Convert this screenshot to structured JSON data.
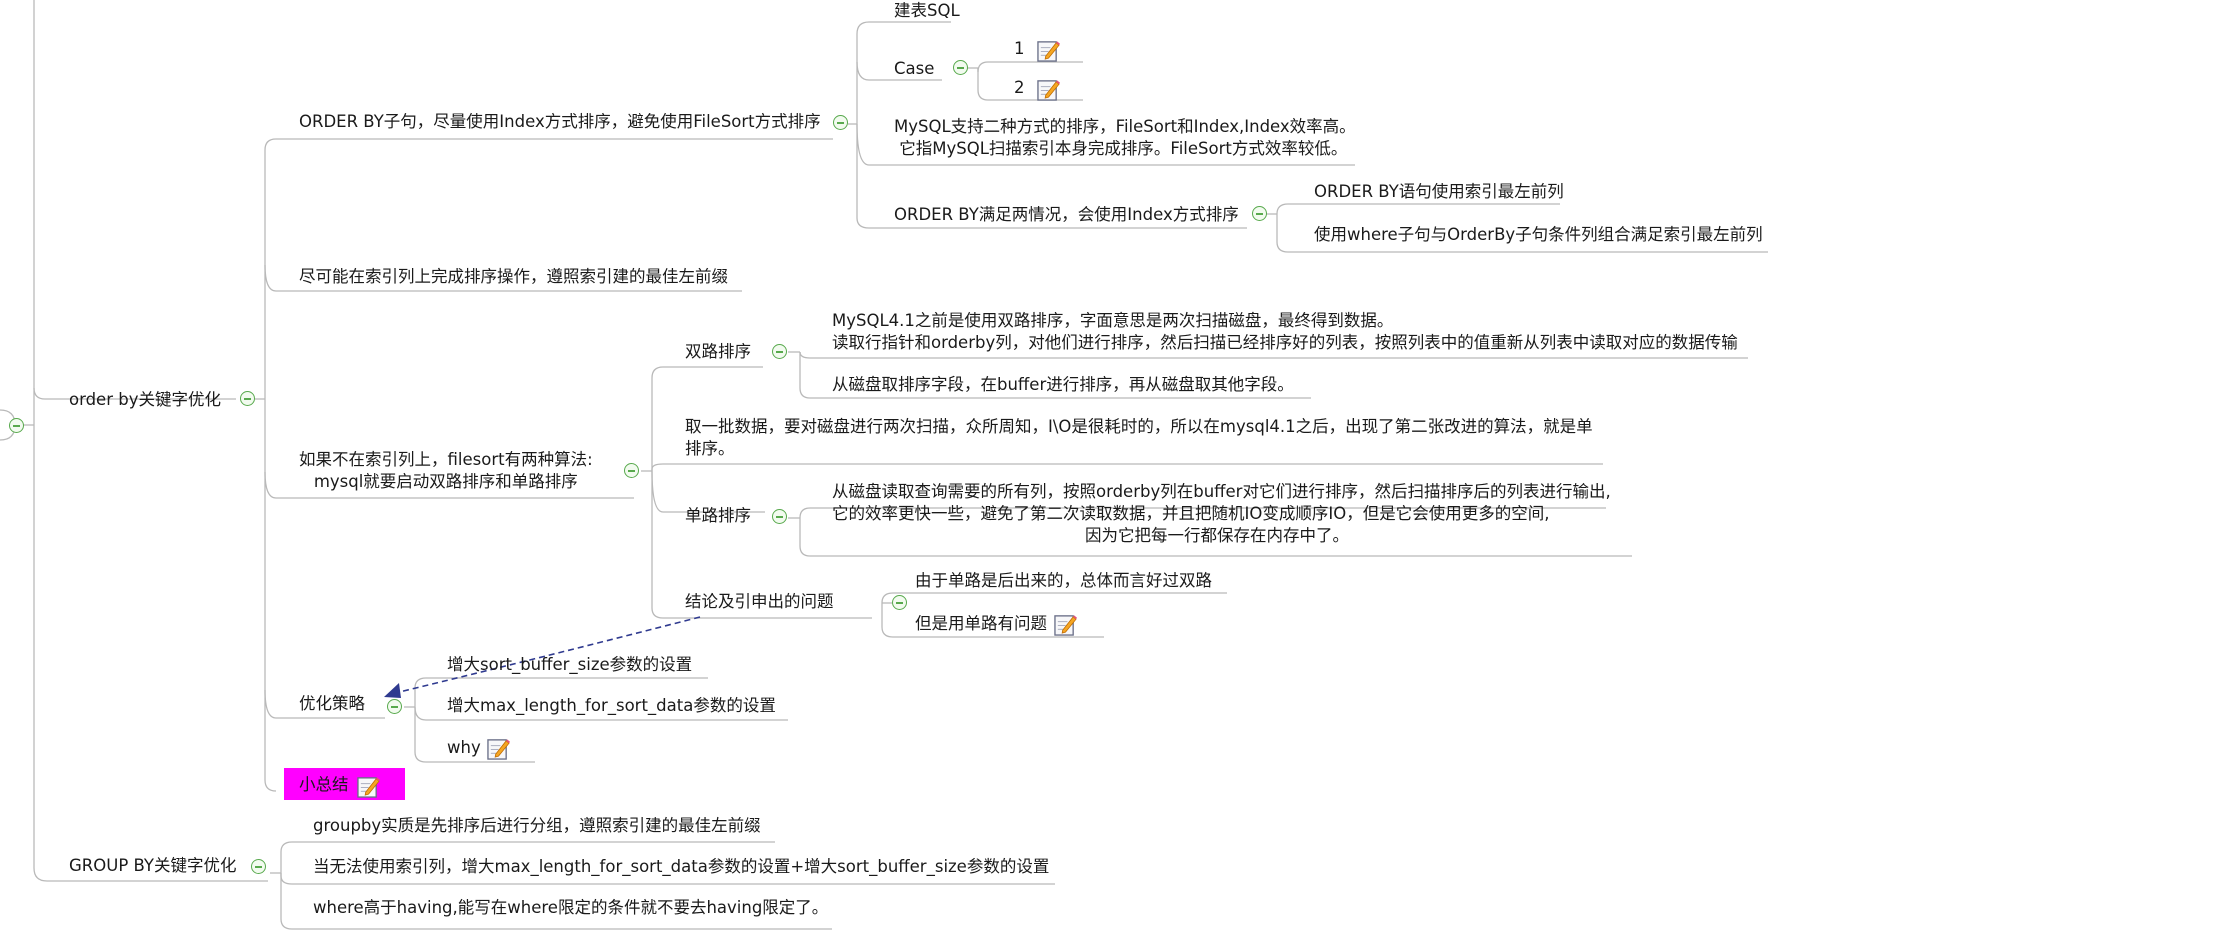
{
  "colors": {
    "line": "#b9b9b9",
    "collapse": "#58a94d",
    "highlight": "#ff00ff",
    "relationship": "#2f3a8f"
  },
  "nodes": {
    "order_by": "order by关键字优化",
    "order_by_clause": "ORDER BY子句，尽量使用Index方式排序，避免使用FileSort方式排序",
    "create_sql": "建表SQL",
    "case": "Case",
    "case_1": "1",
    "case_2": "2",
    "two_sorts": "MySQL支持二种方式的排序，FileSort和Index,Index效率高。\n 它指MySQL扫描索引本身完成排序。FileSort方式效率较低。",
    "two_cases": "ORDER BY满足两情况，会使用Index方式排序",
    "case_leftmost": "ORDER BY语句使用索引最左前列",
    "case_where": "使用where子句与OrderBy子句条件列组合满足索引最左前列",
    "on_index": "尽可能在索引列上完成排序操作，遵照索引建的最佳左前缀",
    "filesort": "如果不在索引列上，filesort有两种算法:\nmysql就要启动双路排序和单路排序",
    "double": "双路排序",
    "double_desc": "MySQL4.1之前是使用双路排序，字面意思是两次扫描磁盘，最终得到数据。\n读取行指针和orderby列，对他们进行排序，然后扫描已经排序好的列表，按照列表中的值重新从列表中读取对应的数据传输",
    "double_step": "从磁盘取排序字段，在buffer进行排序，再从磁盘取其他字段。",
    "batch": "取一批数据，要对磁盘进行两次扫描，众所周知，I\\O是很耗时的，所以在mysql4.1之后，出现了第二张改进的算法，就是单\n排序。",
    "single": "单路排序",
    "single_desc": "从磁盘读取查询需要的所有列，按照orderby列在buffer对它们进行排序，然后扫描排序后的列表进行输出,\n它的效率更快一些，避免了第二次读取数据，并且把随机IO变成顺序IO，但是它会使用更多的空间,\n因为它把每一行都保存在内存中了。",
    "conclusion": "结论及引申出的问题",
    "concl_1": "由于单路是后出来的，总体而言好过双路",
    "concl_2": "但是用单路有问题",
    "strategy": "优化策略",
    "strat_1": "增大sort_buffer_size参数的设置",
    "strat_2": "增大max_length_for_sort_data参数的设置",
    "strat_why": "why",
    "summary": "小总结",
    "group_by": "GROUP BY关键字优化",
    "group_1": "groupby实质是先排序后进行分组，遵照索引建的最佳左前缀",
    "group_2": "当无法使用索引列，增大max_length_for_sort_data参数的设置+增大sort_buffer_size参数的设置",
    "group_3": "where高于having,能写在where限定的条件就不要去having限定了。"
  },
  "icons": {
    "collapse": "collapse-minus-icon",
    "note": "note-pencil-icon"
  }
}
